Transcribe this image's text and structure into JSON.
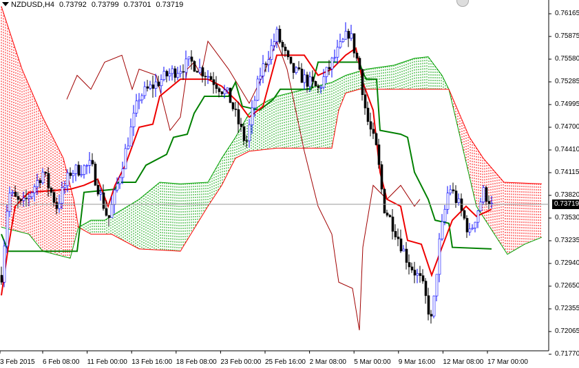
{
  "header": {
    "symbol": "NZDUSD,H4",
    "open": "0.73792",
    "high": "0.73799",
    "low": "0.73701",
    "close": "0.73719"
  },
  "current_price_label": "0.73719",
  "chart_data": {
    "type": "candlestick",
    "title": "NZDUSD,H4",
    "ylim": [
      0.7177,
      0.76165
    ],
    "y_ticks": [
      "0.76165",
      "0.75875",
      "0.75580",
      "0.75285",
      "0.74995",
      "0.74700",
      "0.74410",
      "0.74115",
      "0.73820",
      "0.73530",
      "0.73235",
      "0.72940",
      "0.72650",
      "0.72355",
      "0.72065",
      "0.71770"
    ],
    "x_ticks": [
      "3 Feb 2015",
      "6 Feb 08:00",
      "11 Feb 00:00",
      "13 Feb 16:00",
      "18 Feb 08:00",
      "23 Feb 00:00",
      "25 Feb 16:00",
      "2 Mar 08:00",
      "5 Mar 00:00",
      "9 Mar 16:00",
      "12 Mar 08:00",
      "17 Mar 00:00"
    ],
    "close_path": [
      [
        0,
        0.7279
      ],
      [
        2.5,
        0.7386
      ],
      [
        7.5,
        0.7368
      ],
      [
        15,
        0.7412
      ],
      [
        20,
        0.7368
      ],
      [
        25,
        0.7412
      ],
      [
        32.5,
        0.7421
      ],
      [
        38.75,
        0.735
      ],
      [
        42.5,
        0.7403
      ],
      [
        50,
        0.751
      ],
      [
        60,
        0.7537
      ],
      [
        68.75,
        0.7554
      ],
      [
        75,
        0.7537
      ],
      [
        82.5,
        0.751
      ],
      [
        88.75,
        0.7448
      ],
      [
        93.75,
        0.7537
      ],
      [
        100,
        0.759
      ],
      [
        105,
        0.7545
      ],
      [
        115,
        0.7519
      ],
      [
        120,
        0.7554
      ],
      [
        126.25,
        0.7594
      ],
      [
        130,
        0.7545
      ],
      [
        132.5,
        0.7483
      ],
      [
        136.25,
        0.7439
      ],
      [
        138.75,
        0.7368
      ],
      [
        142.5,
        0.7341
      ],
      [
        147.5,
        0.7297
      ],
      [
        152.5,
        0.727
      ],
      [
        156.25,
        0.7217
      ],
      [
        158.75,
        0.7315
      ],
      [
        162.5,
        0.7395
      ],
      [
        166.25,
        0.7368
      ],
      [
        170,
        0.7332
      ],
      [
        175,
        0.7386
      ],
      [
        178,
        0.73719
      ]
    ],
    "tenkan": [
      [
        0,
        0.7253
      ],
      [
        2.5,
        0.7315
      ],
      [
        5,
        0.7368
      ],
      [
        10,
        0.7386
      ],
      [
        25,
        0.739
      ],
      [
        30,
        0.7395
      ],
      [
        35,
        0.7403
      ],
      [
        38.75,
        0.7368
      ],
      [
        41.25,
        0.7395
      ],
      [
        45,
        0.7421
      ],
      [
        50,
        0.747
      ],
      [
        55,
        0.7474
      ],
      [
        57.5,
        0.751
      ],
      [
        65,
        0.7532
      ],
      [
        75,
        0.7532
      ],
      [
        80,
        0.7523
      ],
      [
        86.25,
        0.7501
      ],
      [
        90,
        0.7483
      ],
      [
        95,
        0.7497
      ],
      [
        100,
        0.7563
      ],
      [
        110,
        0.7563
      ],
      [
        115,
        0.7537
      ],
      [
        120,
        0.7545
      ],
      [
        125,
        0.7563
      ],
      [
        128.75,
        0.7572
      ],
      [
        131.25,
        0.7528
      ],
      [
        135,
        0.7492
      ],
      [
        137.5,
        0.7412
      ],
      [
        140,
        0.7377
      ],
      [
        145,
        0.7368
      ],
      [
        147.5,
        0.7324
      ],
      [
        152.5,
        0.7319
      ],
      [
        156.25,
        0.7279
      ],
      [
        160,
        0.7315
      ],
      [
        163.75,
        0.735
      ],
      [
        168.75,
        0.7368
      ],
      [
        172.5,
        0.7355
      ],
      [
        178,
        0.7364
      ]
    ],
    "kijun": [
      [
        0,
        0.7332
      ],
      [
        2.5,
        0.731
      ],
      [
        27.5,
        0.731
      ],
      [
        30,
        0.7386
      ],
      [
        41.25,
        0.739
      ],
      [
        42.5,
        0.7399
      ],
      [
        48.75,
        0.7399
      ],
      [
        52.5,
        0.7421
      ],
      [
        60,
        0.7435
      ],
      [
        62.5,
        0.7457
      ],
      [
        67.5,
        0.7461
      ],
      [
        70,
        0.7488
      ],
      [
        73.75,
        0.751
      ],
      [
        82.5,
        0.751
      ],
      [
        85,
        0.7528
      ],
      [
        87.5,
        0.7497
      ],
      [
        93.75,
        0.7492
      ],
      [
        98.75,
        0.7506
      ],
      [
        101.25,
        0.7519
      ],
      [
        112.5,
        0.7519
      ],
      [
        115,
        0.7554
      ],
      [
        130,
        0.7554
      ],
      [
        131.25,
        0.7541
      ],
      [
        132.5,
        0.7532
      ],
      [
        136.25,
        0.7532
      ],
      [
        137.5,
        0.7466
      ],
      [
        145,
        0.7461
      ],
      [
        147.5,
        0.7457
      ],
      [
        150,
        0.7412
      ],
      [
        155,
        0.7377
      ],
      [
        157.5,
        0.735
      ],
      [
        162.5,
        0.7346
      ],
      [
        163.75,
        0.7315
      ],
      [
        178,
        0.7313
      ]
    ],
    "chikou": [
      [
        23.75,
        0.7506
      ],
      [
        27.5,
        0.7537
      ],
      [
        32.5,
        0.7519
      ],
      [
        37.5,
        0.7554
      ],
      [
        43.75,
        0.7563
      ],
      [
        47.5,
        0.7519
      ],
      [
        50,
        0.7545
      ],
      [
        56.25,
        0.7537
      ],
      [
        61.25,
        0.7466
      ],
      [
        65,
        0.7483
      ],
      [
        67.5,
        0.7545
      ],
      [
        70,
        0.7554
      ],
      [
        72.5,
        0.7537
      ],
      [
        75,
        0.7581
      ],
      [
        82.5,
        0.7545
      ],
      [
        90,
        0.7501
      ],
      [
        95,
        0.7537
      ],
      [
        100,
        0.7581
      ],
      [
        103.75,
        0.7545
      ],
      [
        110,
        0.7439
      ],
      [
        115,
        0.7368
      ],
      [
        120,
        0.7332
      ],
      [
        122.5,
        0.727
      ],
      [
        127.5,
        0.7262
      ],
      [
        130,
        0.7208
      ],
      [
        131.25,
        0.7315
      ],
      [
        135,
        0.7395
      ],
      [
        140,
        0.7377
      ],
      [
        145,
        0.7395
      ],
      [
        150,
        0.7368
      ],
      [
        152,
        0.7377
      ]
    ],
    "senkou_a": [
      [
        0,
        0.7341
      ],
      [
        10,
        0.7332
      ],
      [
        15,
        0.731
      ],
      [
        25,
        0.7301
      ],
      [
        28,
        0.7341
      ],
      [
        32.5,
        0.735
      ],
      [
        37.5,
        0.735
      ],
      [
        50,
        0.7377
      ],
      [
        57.5,
        0.7399
      ],
      [
        65,
        0.7397
      ],
      [
        75,
        0.7399
      ],
      [
        80,
        0.743
      ],
      [
        85,
        0.7457
      ],
      [
        90,
        0.7488
      ],
      [
        95,
        0.7501
      ],
      [
        100,
        0.751
      ],
      [
        110,
        0.7519
      ],
      [
        120,
        0.7528
      ],
      [
        125,
        0.7537
      ],
      [
        132.5,
        0.7545
      ],
      [
        142.5,
        0.755
      ],
      [
        150,
        0.7559
      ],
      [
        155,
        0.7561
      ],
      [
        160,
        0.7537
      ],
      [
        162.5,
        0.7519
      ],
      [
        172.5,
        0.7368
      ],
      [
        183.75,
        0.7306
      ],
      [
        190,
        0.7319
      ],
      [
        196.25,
        0.7328
      ]
    ],
    "senkou_b": [
      [
        0,
        0.7626
      ],
      [
        7.5,
        0.7545
      ],
      [
        15,
        0.7483
      ],
      [
        22.5,
        0.743
      ],
      [
        26.25,
        0.7377
      ],
      [
        28,
        0.7341
      ],
      [
        32.5,
        0.7332
      ],
      [
        40,
        0.7332
      ],
      [
        50,
        0.7313
      ],
      [
        65,
        0.731
      ],
      [
        75,
        0.7368
      ],
      [
        80,
        0.7395
      ],
      [
        85,
        0.743
      ],
      [
        90,
        0.7439
      ],
      [
        100,
        0.7443
      ],
      [
        120,
        0.7443
      ],
      [
        122.5,
        0.7492
      ],
      [
        125,
        0.7514
      ],
      [
        130,
        0.7519
      ],
      [
        150,
        0.7519
      ],
      [
        162.5,
        0.7519
      ],
      [
        170,
        0.7457
      ],
      [
        175,
        0.743
      ],
      [
        182.5,
        0.7399
      ],
      [
        196.25,
        0.7397
      ]
    ]
  }
}
